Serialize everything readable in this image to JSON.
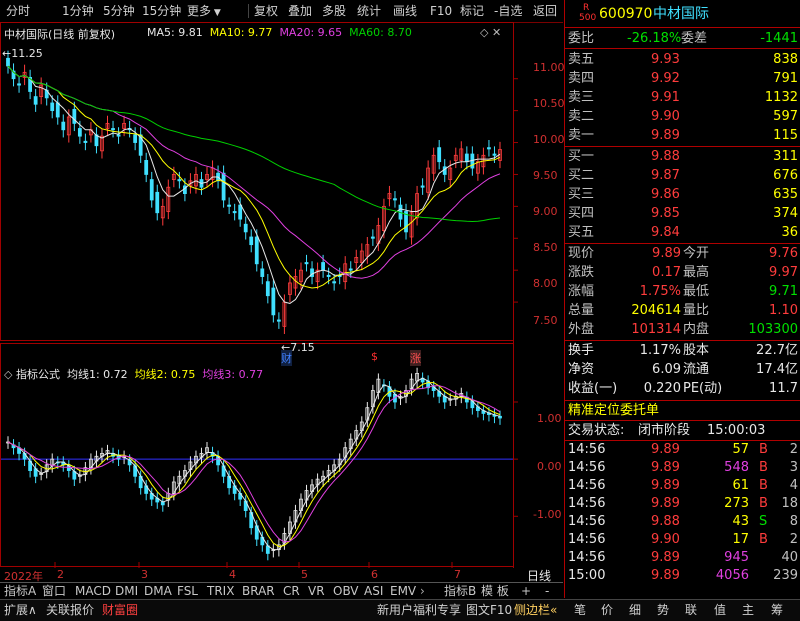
{
  "toolbar": {
    "periods": [
      "分时",
      "1分钟",
      "5分钟",
      "15分钟",
      "更多"
    ],
    "actions": [
      "复权",
      "叠加",
      "多股",
      "统计",
      "画线",
      "F10",
      "标记",
      "-自选",
      "返回"
    ]
  },
  "main_chart": {
    "title": "中材国际(日线 前复权)",
    "ma_legend": [
      {
        "label": "MA5: 9.81",
        "color": "#e8e8e8"
      },
      {
        "label": "MA10: 9.77",
        "color": "#ffff00"
      },
      {
        "label": "MA20: 9.65",
        "color": "#e040e0"
      },
      {
        "label": "MA60: 8.70",
        "color": "#00d000"
      }
    ],
    "high_mark": "11.25",
    "low_mark": "7.15",
    "markers": [
      "财",
      "$",
      "涨"
    ],
    "y_ticks": [
      "11.00",
      "10.50",
      "10.00",
      "9.50",
      "9.00",
      "8.50",
      "8.00",
      "7.50"
    ]
  },
  "indicator_chart": {
    "title": "指标公式",
    "legend": [
      {
        "label": "均线1: 0.72",
        "color": "#e8e8e8"
      },
      {
        "label": "均线2: 0.75",
        "color": "#ffff00"
      },
      {
        "label": "均线3: 0.77",
        "color": "#e040e0"
      }
    ],
    "y_ticks": [
      "1.00",
      "0.00",
      "-1.00"
    ]
  },
  "x_axis": {
    "labels": [
      "2022年",
      "2",
      "3",
      "4",
      "5",
      "6",
      "7"
    ],
    "period": "日线"
  },
  "tabs": [
    "指标A",
    "窗口",
    "MACD",
    "DMI",
    "DMA",
    "FSL",
    "TRIX",
    "BRAR",
    "CR",
    "VR",
    "OBV",
    "ASI",
    "EMV",
    "指标B",
    "模 板",
    "+",
    "-"
  ],
  "status_bar": {
    "left": [
      "扩展∧",
      "关联报价",
      "财富圈"
    ],
    "promo": "新用户福利专享",
    "right_btns": [
      "图文F10",
      "侧边栏«"
    ],
    "side_tabs": [
      "笔",
      "价",
      "细",
      "势",
      "联",
      "值",
      "主",
      "筹"
    ]
  },
  "quote": {
    "code": "600970",
    "name": "中材国际",
    "badge_top": "R",
    "badge_bottom": "500",
    "weibi_label": "委比",
    "weibi": "-26.18%",
    "weicha_label": "委差",
    "weicha": "-1441",
    "asks": [
      {
        "label": "卖五",
        "price": "9.93",
        "vol": "838"
      },
      {
        "label": "卖四",
        "price": "9.92",
        "vol": "791"
      },
      {
        "label": "卖三",
        "price": "9.91",
        "vol": "1132"
      },
      {
        "label": "卖二",
        "price": "9.90",
        "vol": "597"
      },
      {
        "label": "卖一",
        "price": "9.89",
        "vol": "115"
      }
    ],
    "bids": [
      {
        "label": "买一",
        "price": "9.88",
        "vol": "311"
      },
      {
        "label": "买二",
        "price": "9.87",
        "vol": "676"
      },
      {
        "label": "买三",
        "price": "9.86",
        "vol": "635"
      },
      {
        "label": "买四",
        "price": "9.85",
        "vol": "374"
      },
      {
        "label": "买五",
        "price": "9.84",
        "vol": "36"
      }
    ],
    "stats": [
      {
        "l1": "现价",
        "v1": "9.89",
        "c1": "red",
        "l2": "今开",
        "v2": "9.76",
        "c2": "red"
      },
      {
        "l1": "涨跌",
        "v1": "0.17",
        "c1": "red",
        "l2": "最高",
        "v2": "9.97",
        "c2": "red"
      },
      {
        "l1": "涨幅",
        "v1": "1.75%",
        "c1": "red",
        "l2": "最低",
        "v2": "9.71",
        "c2": "green"
      },
      {
        "l1": "总量",
        "v1": "204614",
        "c1": "yellow",
        "l2": "量比",
        "v2": "1.10",
        "c2": "red"
      },
      {
        "l1": "外盘",
        "v1": "101314",
        "c1": "red",
        "l2": "内盘",
        "v2": "103300",
        "c2": "green"
      }
    ],
    "stats2": [
      {
        "l1": "换手",
        "v1": "1.17%",
        "l2": "股本",
        "v2": "22.7亿"
      },
      {
        "l1": "净资",
        "v1": "6.09",
        "l2": "流通",
        "v2": "17.4亿"
      },
      {
        "l1": "收益(一)",
        "v1": "0.220",
        "l2": "PE(动)",
        "v2": "11.7"
      }
    ],
    "order_link": "精准定位委托单",
    "trade_state_label": "交易状态:",
    "trade_state": "闭市阶段",
    "trade_time": "15:00:03",
    "ticks": [
      {
        "t": "14:56",
        "p": "9.89",
        "v": "57",
        "vc": "yellow",
        "d": "B",
        "dc": "red",
        "n": "2"
      },
      {
        "t": "14:56",
        "p": "9.89",
        "v": "548",
        "vc": "mag",
        "d": "B",
        "dc": "red",
        "n": "3"
      },
      {
        "t": "14:56",
        "p": "9.89",
        "v": "61",
        "vc": "yellow",
        "d": "B",
        "dc": "red",
        "n": "4"
      },
      {
        "t": "14:56",
        "p": "9.89",
        "v": "273",
        "vc": "yellow",
        "d": "B",
        "dc": "red",
        "n": "18"
      },
      {
        "t": "14:56",
        "p": "9.88",
        "v": "43",
        "vc": "yellow",
        "d": "S",
        "dc": "green",
        "n": "8"
      },
      {
        "t": "14:56",
        "p": "9.90",
        "v": "17",
        "vc": "yellow",
        "d": "B",
        "dc": "red",
        "n": "2"
      },
      {
        "t": "14:56",
        "p": "9.89",
        "v": "945",
        "vc": "mag",
        "d": "",
        "dc": "red",
        "n": "40"
      },
      {
        "t": "15:00",
        "p": "9.89",
        "v": "4056",
        "vc": "mag",
        "d": "",
        "dc": "red",
        "n": "239"
      }
    ]
  },
  "chart_data": {
    "type": "candlestick",
    "note_values": "approximate daily closes read from the 日线 chart, Jan–Jul 2022",
    "price_range": [
      7.0,
      11.45
    ],
    "closes": [
      11.2,
      11.0,
      10.9,
      11.1,
      10.8,
      10.6,
      10.9,
      10.7,
      10.5,
      10.4,
      10.2,
      10.4,
      10.3,
      10.1,
      10.0,
      10.2,
      9.95,
      10.1,
      10.3,
      10.2,
      10.1,
      10.3,
      10.2,
      10.0,
      9.8,
      9.5,
      9.1,
      8.9,
      9.0,
      9.3,
      9.5,
      9.4,
      9.2,
      9.4,
      9.5,
      9.3,
      9.5,
      9.6,
      9.4,
      9.1,
      9.0,
      8.9,
      8.8,
      8.6,
      8.4,
      8.1,
      7.9,
      7.6,
      7.3,
      7.2,
      7.5,
      7.8,
      7.9,
      8.0,
      8.1,
      7.9,
      8.0,
      8.0,
      7.9,
      7.8,
      7.9,
      8.1,
      8.0,
      8.2,
      8.3,
      8.4,
      8.5,
      8.7,
      9.0,
      9.2,
      9.1,
      8.8,
      8.6,
      8.9,
      9.2,
      9.3,
      9.6,
      9.8,
      9.7,
      9.5,
      9.6,
      9.8,
      9.9,
      9.7,
      9.6,
      9.7,
      9.8,
      9.9,
      9.8,
      9.89
    ],
    "ma": [
      {
        "name": "MA5",
        "last": 9.81
      },
      {
        "name": "MA10",
        "last": 9.77
      },
      {
        "name": "MA20",
        "last": 9.65
      },
      {
        "name": "MA60",
        "last": 8.7
      }
    ],
    "indicator_range": [
      -1.8,
      1.7
    ],
    "indicator": [
      0.3,
      0.2,
      0.1,
      0.0,
      -0.2,
      -0.3,
      -0.25,
      -0.1,
      0.0,
      -0.05,
      -0.1,
      -0.2,
      -0.35,
      -0.3,
      -0.15,
      0.0,
      0.05,
      0.1,
      0.15,
      0.05,
      0.0,
      0.05,
      -0.1,
      -0.3,
      -0.5,
      -0.6,
      -0.7,
      -0.75,
      -0.8,
      -0.6,
      -0.4,
      -0.3,
      -0.2,
      -0.05,
      0.05,
      0.1,
      0.2,
      0.05,
      -0.1,
      -0.3,
      -0.5,
      -0.6,
      -0.7,
      -0.9,
      -1.2,
      -1.4,
      -1.5,
      -1.65,
      -1.6,
      -1.5,
      -1.3,
      -1.1,
      -0.9,
      -0.7,
      -0.55,
      -0.45,
      -0.35,
      -0.3,
      -0.2,
      -0.1,
      0.0,
      0.2,
      0.35,
      0.5,
      0.65,
      0.9,
      1.2,
      1.4,
      1.3,
      1.1,
      1.0,
      1.1,
      1.2,
      1.4,
      1.5,
      1.35,
      1.25,
      1.2,
      1.1,
      1.0,
      1.05,
      1.1,
      1.15,
      1.0,
      0.9,
      0.85,
      0.8,
      0.78,
      0.75,
      0.72
    ]
  }
}
